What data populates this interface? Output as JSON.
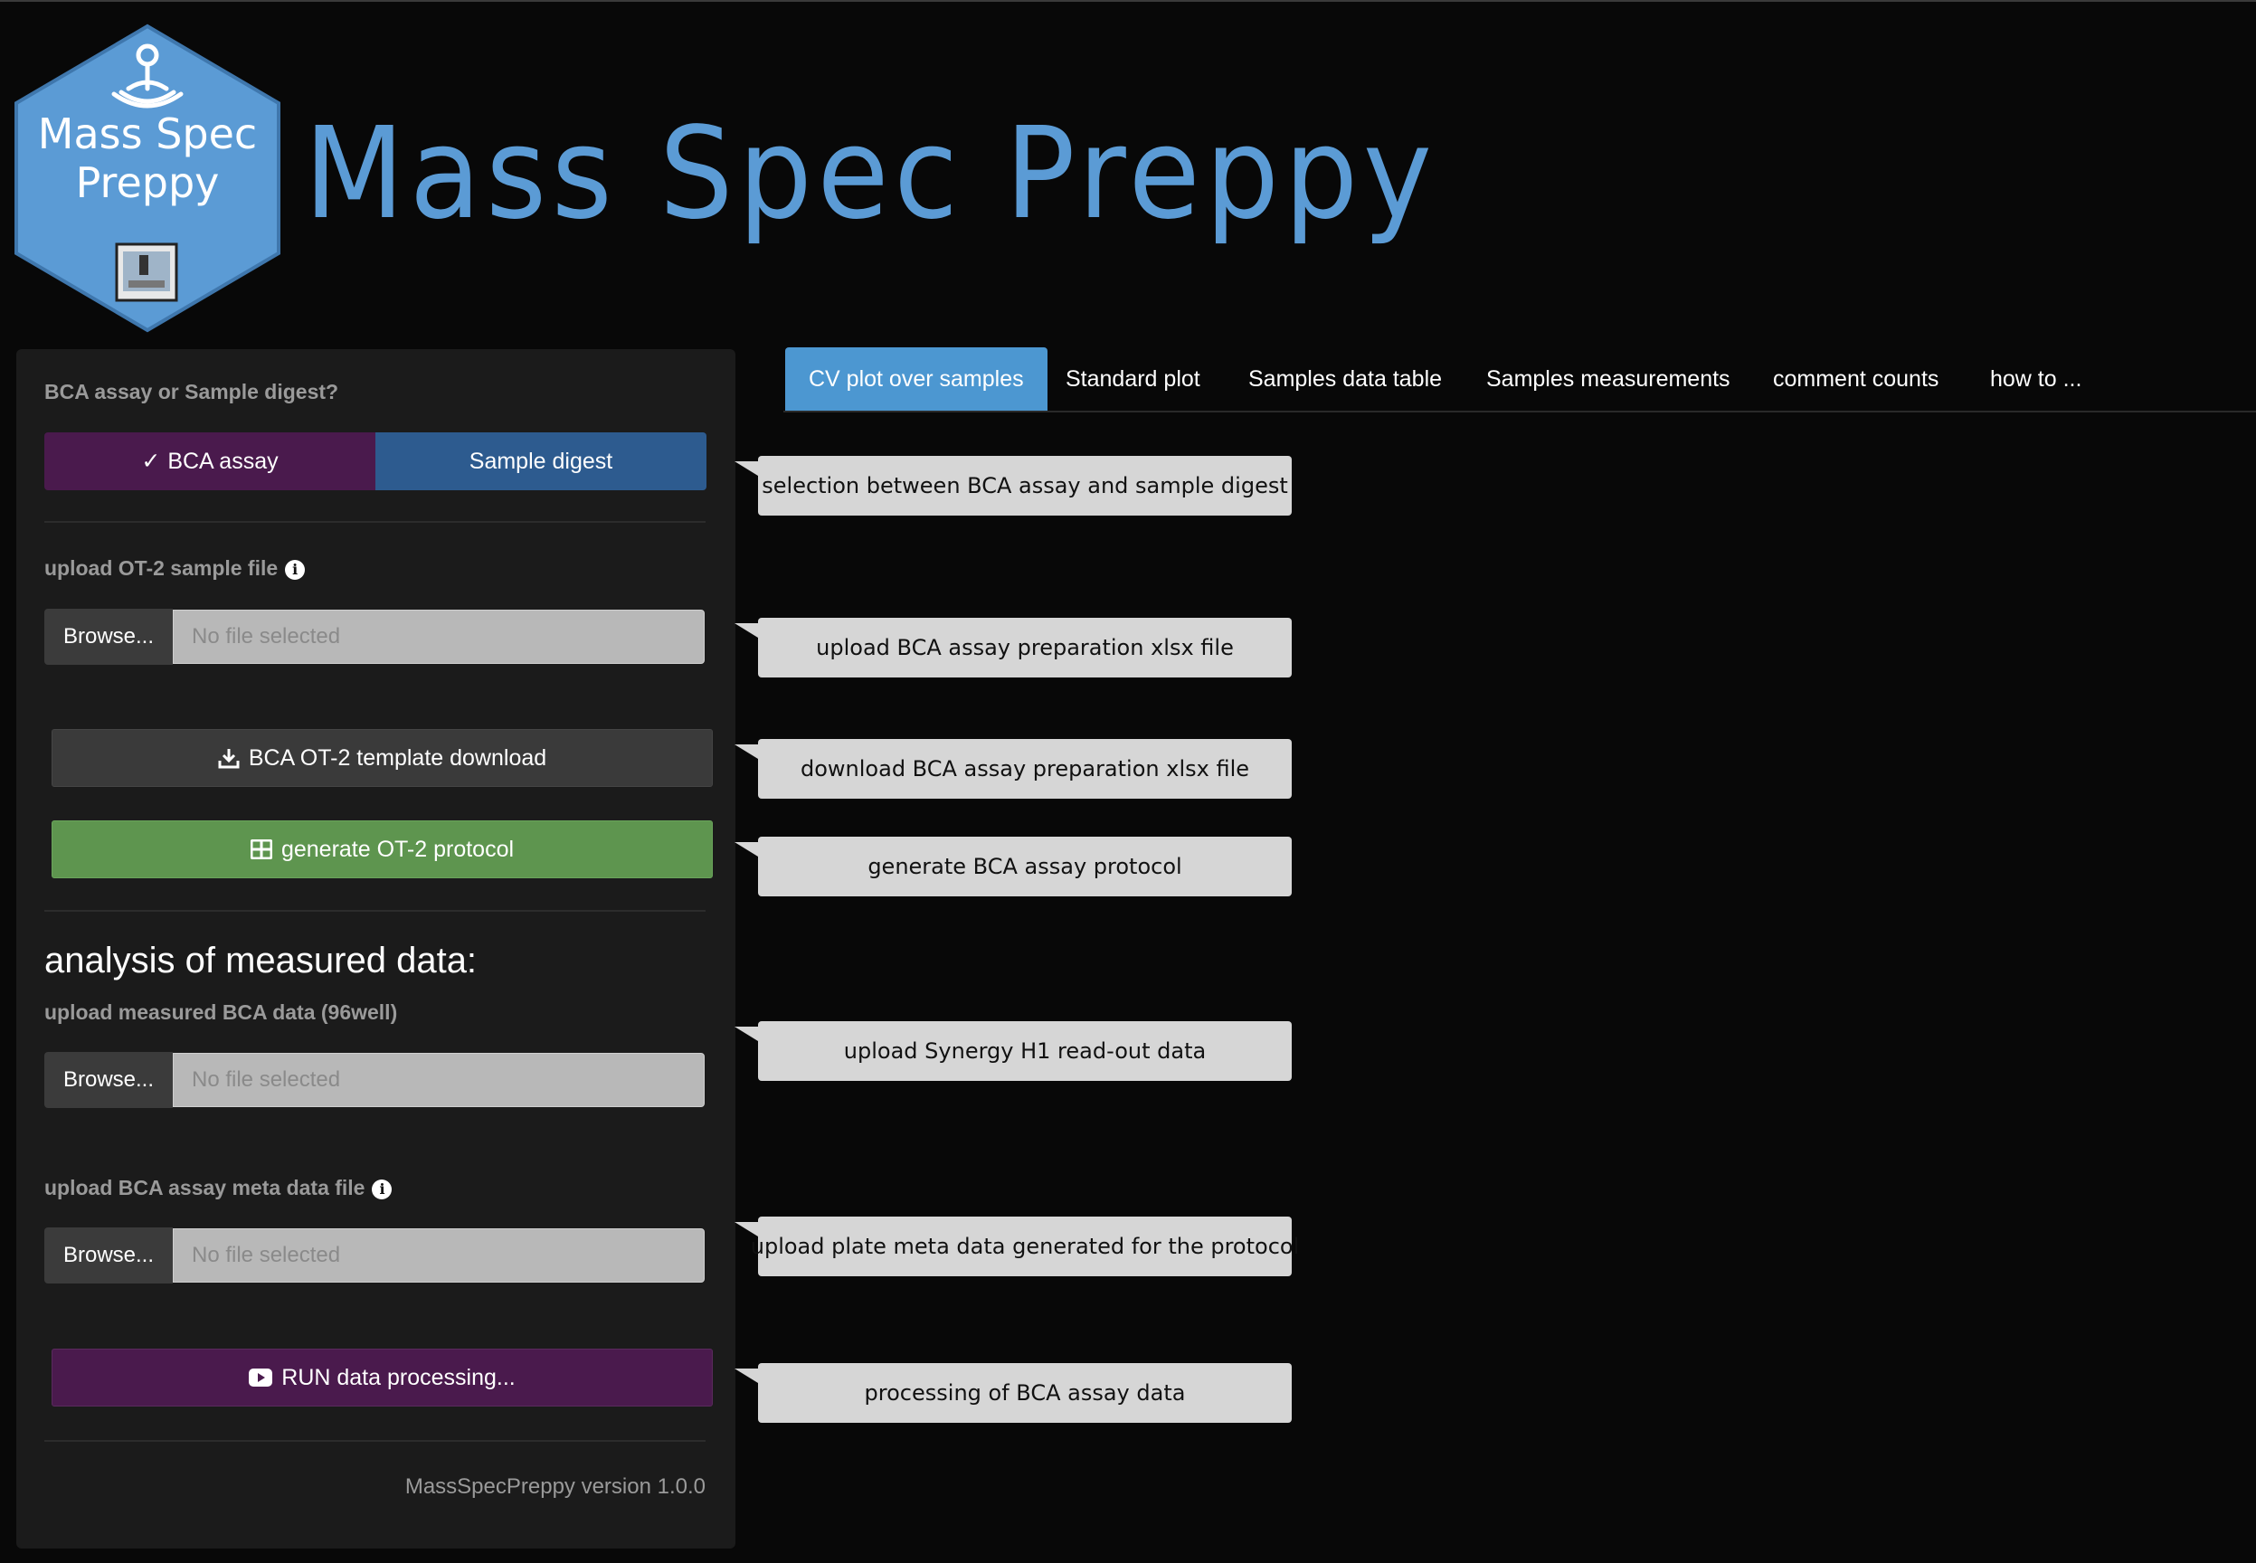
{
  "logo": {
    "line1": "Mass Spec",
    "line2": "Preppy",
    "colors": {
      "hex_fill": "#5b9bd5",
      "hex_stroke": "#3f77ad"
    }
  },
  "app": {
    "title": "Mass Spec Preppy",
    "accent": "#5b9bd5"
  },
  "sidebar": {
    "mode_label": "BCA assay or Sample digest?",
    "mode_options": [
      "BCA assay",
      "Sample digest"
    ],
    "mode_selected": "BCA assay",
    "ot2_upload": {
      "label": "upload OT-2 sample file",
      "browse": "Browse...",
      "placeholder": "No file selected"
    },
    "template_download": {
      "label": "BCA OT-2 template download",
      "icon": "download-icon"
    },
    "generate_protocol": {
      "label": "generate OT-2 protocol",
      "icon": "table-icon",
      "color": "#5e954f"
    },
    "analysis_heading": "analysis of measured data:",
    "measured_upload": {
      "label": "upload measured BCA data (96well)",
      "browse": "Browse...",
      "placeholder": "No file selected"
    },
    "meta_upload": {
      "label": "upload BCA assay meta data file",
      "browse": "Browse...",
      "placeholder": "No file selected"
    },
    "run_button": {
      "label": "RUN data processing...",
      "icon": "youtube-play-icon",
      "color": "#4a1a4d"
    },
    "version": "MassSpecPreppy version 1.0.0"
  },
  "tabs": [
    {
      "label": "CV plot over samples",
      "active": true
    },
    {
      "label": "Standard plot",
      "active": false
    },
    {
      "label": "Samples data table",
      "active": false
    },
    {
      "label": "Samples measurements",
      "active": false
    },
    {
      "label": "comment counts",
      "active": false
    },
    {
      "label": "how to ...",
      "active": false
    }
  ],
  "callouts": [
    "selection between BCA assay and sample digest",
    "upload BCA assay preparation xlsx file",
    "download BCA assay preparation xlsx file",
    "generate BCA assay protocol",
    "upload Synergy H1 read-out data",
    "upload plate meta data generated for the protocol",
    "processing of BCA assay data"
  ]
}
